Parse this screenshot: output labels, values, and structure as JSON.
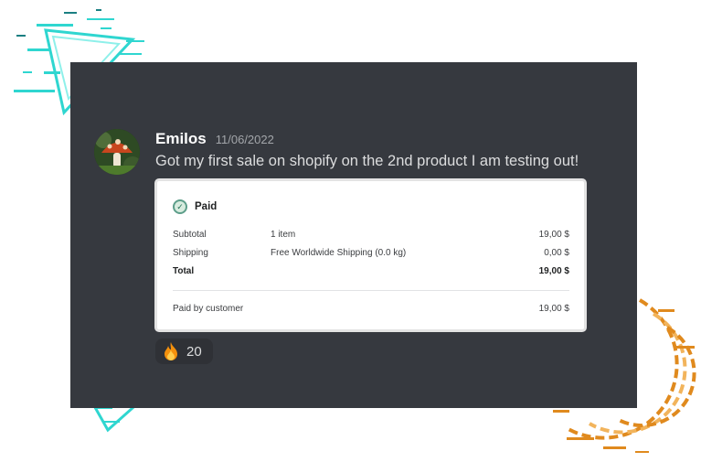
{
  "message": {
    "author": "Emilos",
    "timestamp": "11/06/2022",
    "text": "Got my first sale on shopify on the 2nd product I am testing out!",
    "avatar_icon": "mushroom-avatar"
  },
  "order_card": {
    "status": "Paid",
    "status_icon": "check-circle-icon",
    "rows": [
      {
        "label": "Subtotal",
        "detail": "1 item",
        "amount": "19,00 $"
      },
      {
        "label": "Shipping",
        "detail": "Free Worldwide Shipping (0.0 kg)",
        "amount": "0,00 $"
      },
      {
        "label": "Total",
        "detail": "",
        "amount": "19,00 $"
      }
    ],
    "paid_by": {
      "label": "Paid by customer",
      "amount": "19,00 $"
    }
  },
  "reaction": {
    "emoji": "fire-icon",
    "count": "20"
  },
  "colors": {
    "chat_background": "#36393f",
    "username": "#ffffff",
    "timestamp": "#a3a6aa",
    "message_text": "#dcddde",
    "reaction_background": "#2f3136",
    "paid_icon": "#5d9e8a",
    "deco_cyan": "#2fd6d0",
    "deco_orange": "#e08a1e"
  }
}
